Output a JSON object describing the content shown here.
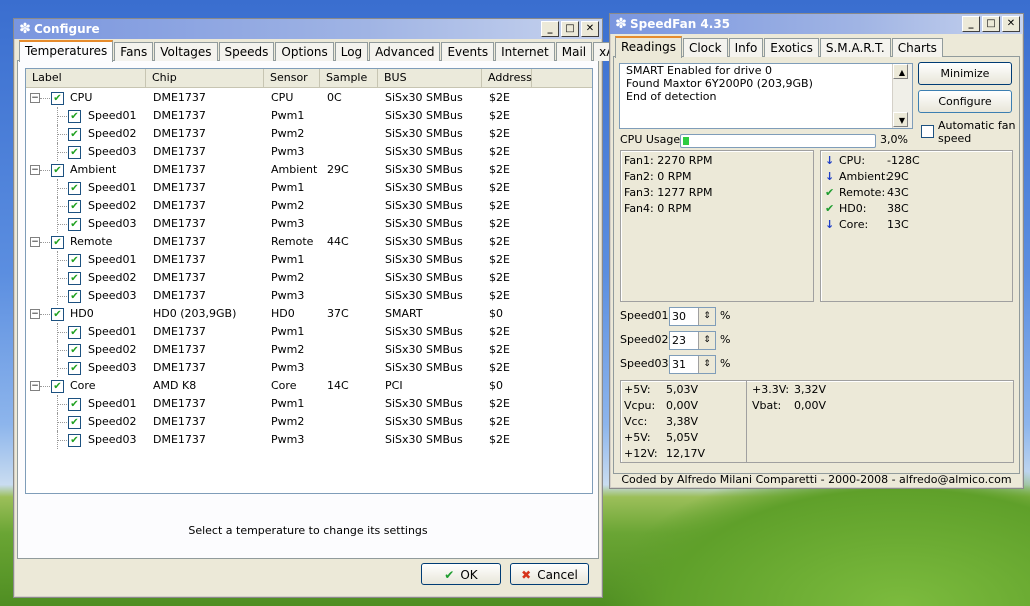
{
  "configure": {
    "title": "Configure",
    "tabs": [
      "Temperatures",
      "Fans",
      "Voltages",
      "Speeds",
      "Options",
      "Log",
      "Advanced",
      "Events",
      "Internet",
      "Mail",
      "xAP"
    ],
    "columns": [
      "Label",
      "Chip",
      "Sensor",
      "Sample",
      "BUS",
      "Address"
    ],
    "rows": [
      {
        "level": 0,
        "label": "CPU",
        "chip": "DME1737",
        "sensor": "CPU",
        "sample": "0C",
        "bus": "SiSx30 SMBus",
        "address": "$2E"
      },
      {
        "level": 1,
        "label": "Speed01",
        "chip": "DME1737",
        "sensor": "Pwm1",
        "sample": "",
        "bus": "SiSx30 SMBus",
        "address": "$2E"
      },
      {
        "level": 1,
        "label": "Speed02",
        "chip": "DME1737",
        "sensor": "Pwm2",
        "sample": "",
        "bus": "SiSx30 SMBus",
        "address": "$2E"
      },
      {
        "level": 1,
        "label": "Speed03",
        "chip": "DME1737",
        "sensor": "Pwm3",
        "sample": "",
        "bus": "SiSx30 SMBus",
        "address": "$2E"
      },
      {
        "level": 0,
        "label": "Ambient",
        "chip": "DME1737",
        "sensor": "Ambient",
        "sample": "29C",
        "bus": "SiSx30 SMBus",
        "address": "$2E"
      },
      {
        "level": 1,
        "label": "Speed01",
        "chip": "DME1737",
        "sensor": "Pwm1",
        "sample": "",
        "bus": "SiSx30 SMBus",
        "address": "$2E"
      },
      {
        "level": 1,
        "label": "Speed02",
        "chip": "DME1737",
        "sensor": "Pwm2",
        "sample": "",
        "bus": "SiSx30 SMBus",
        "address": "$2E"
      },
      {
        "level": 1,
        "label": "Speed03",
        "chip": "DME1737",
        "sensor": "Pwm3",
        "sample": "",
        "bus": "SiSx30 SMBus",
        "address": "$2E"
      },
      {
        "level": 0,
        "label": "Remote",
        "chip": "DME1737",
        "sensor": "Remote",
        "sample": "44C",
        "bus": "SiSx30 SMBus",
        "address": "$2E"
      },
      {
        "level": 1,
        "label": "Speed01",
        "chip": "DME1737",
        "sensor": "Pwm1",
        "sample": "",
        "bus": "SiSx30 SMBus",
        "address": "$2E"
      },
      {
        "level": 1,
        "label": "Speed02",
        "chip": "DME1737",
        "sensor": "Pwm2",
        "sample": "",
        "bus": "SiSx30 SMBus",
        "address": "$2E"
      },
      {
        "level": 1,
        "label": "Speed03",
        "chip": "DME1737",
        "sensor": "Pwm3",
        "sample": "",
        "bus": "SiSx30 SMBus",
        "address": "$2E"
      },
      {
        "level": 0,
        "label": "HD0",
        "chip": "HD0 (203,9GB)",
        "sensor": "HD0",
        "sample": "37C",
        "bus": "SMART",
        "address": "$0"
      },
      {
        "level": 1,
        "label": "Speed01",
        "chip": "DME1737",
        "sensor": "Pwm1",
        "sample": "",
        "bus": "SiSx30 SMBus",
        "address": "$2E"
      },
      {
        "level": 1,
        "label": "Speed02",
        "chip": "DME1737",
        "sensor": "Pwm2",
        "sample": "",
        "bus": "SiSx30 SMBus",
        "address": "$2E"
      },
      {
        "level": 1,
        "label": "Speed03",
        "chip": "DME1737",
        "sensor": "Pwm3",
        "sample": "",
        "bus": "SiSx30 SMBus",
        "address": "$2E"
      },
      {
        "level": 0,
        "label": "Core",
        "chip": "AMD K8",
        "sensor": "Core",
        "sample": "14C",
        "bus": "PCI",
        "address": "$0"
      },
      {
        "level": 1,
        "label": "Speed01",
        "chip": "DME1737",
        "sensor": "Pwm1",
        "sample": "",
        "bus": "SiSx30 SMBus",
        "address": "$2E"
      },
      {
        "level": 1,
        "label": "Speed02",
        "chip": "DME1737",
        "sensor": "Pwm2",
        "sample": "",
        "bus": "SiSx30 SMBus",
        "address": "$2E"
      },
      {
        "level": 1,
        "label": "Speed03",
        "chip": "DME1737",
        "sensor": "Pwm3",
        "sample": "",
        "bus": "SiSx30 SMBus",
        "address": "$2E"
      }
    ],
    "hint": "Select a temperature to change its settings",
    "ok_label": "OK",
    "cancel_label": "Cancel"
  },
  "speedfan": {
    "title": "SpeedFan 4.35",
    "tabs": [
      "Readings",
      "Clock",
      "Info",
      "Exotics",
      "S.M.A.R.T.",
      "Charts"
    ],
    "log_lines": [
      "SMART Enabled for drive 0",
      "Found Maxtor 6Y200P0 (203,9GB)",
      "End of detection"
    ],
    "minimize_label": "Minimize",
    "configure_label": "Configure",
    "auto_fan_label": "Automatic fan speed",
    "cpu_usage_label": "CPU Usage",
    "cpu_usage_value": "3,0%",
    "cpu_usage_fraction": 0.03,
    "fans": [
      "Fan1: 2270 RPM",
      "Fan2: 0 RPM",
      "Fan3: 1277 RPM",
      "Fan4: 0 RPM"
    ],
    "temps": [
      {
        "icon": "down",
        "label": "CPU:",
        "value": "-128C"
      },
      {
        "icon": "down",
        "label": "Ambient:",
        "value": "29C"
      },
      {
        "icon": "ok",
        "label": "Remote:",
        "value": "43C"
      },
      {
        "icon": "ok",
        "label": "HD0:",
        "value": "38C"
      },
      {
        "icon": "down",
        "label": "Core:",
        "value": "13C"
      }
    ],
    "speeds": [
      {
        "label": "Speed01:",
        "value": "30",
        "unit": "%"
      },
      {
        "label": "Speed02:",
        "value": "23",
        "unit": "%"
      },
      {
        "label": "Speed03:",
        "value": "31",
        "unit": "%"
      }
    ],
    "voltages_left": [
      {
        "label": "+5V:",
        "value": "5,03V"
      },
      {
        "label": "Vcpu:",
        "value": "0,00V"
      },
      {
        "label": "Vcc:",
        "value": "3,38V"
      },
      {
        "label": "+5V:",
        "value": "5,05V"
      },
      {
        "label": "+12V:",
        "value": "12,17V"
      }
    ],
    "voltages_right": [
      {
        "label": "+3.3V:",
        "value": "3,32V"
      },
      {
        "label": "Vbat:",
        "value": "0,00V"
      }
    ],
    "footer": "Coded by Alfredo Milani Comparetti - 2000-2008 - alfredo@almico.com"
  }
}
